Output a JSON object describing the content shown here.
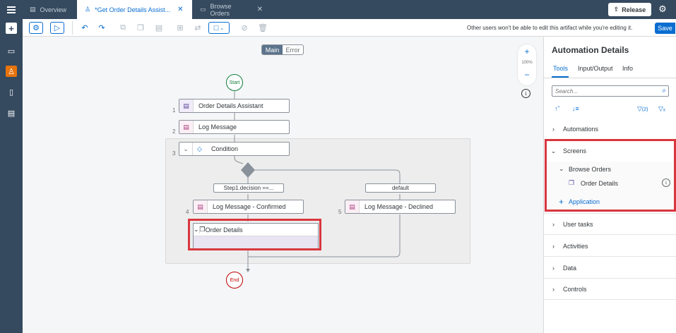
{
  "tabs": [
    {
      "label": "Overview"
    },
    {
      "label": "*Get Order Details Assist..."
    },
    {
      "label": "Browse Orders"
    }
  ],
  "header": {
    "release_label": "Release"
  },
  "toolbar": {
    "note": "Other users won't be able to edit this artifact while you're editing it.",
    "save_label": "Save"
  },
  "canvas": {
    "mode_tabs": [
      "Main",
      "Error"
    ],
    "zoom_level": "100%",
    "start_label": "Start",
    "end_label": "End",
    "steps": [
      {
        "num": "1",
        "label": "Order Details Assistant"
      },
      {
        "num": "2",
        "label": "Log Message"
      },
      {
        "num": "3",
        "label": "Condition"
      },
      {
        "num": "4",
        "label": "Log Message - Confirmed"
      },
      {
        "num": "5",
        "label": "Log Message - Declined"
      }
    ],
    "branches": [
      "Step1.decision ==...",
      "default"
    ],
    "screen_label": "Order Details"
  },
  "panel": {
    "title": "Automation Details",
    "tabs": [
      "Tools",
      "Input/Output",
      "Info"
    ],
    "search_placeholder": "Search...",
    "filter_count": "(2)",
    "sections": [
      "Automations",
      "Screens",
      "User tasks",
      "Activities",
      "Data",
      "Controls"
    ],
    "screens": {
      "group": "Browse Orders",
      "item": "Order Details",
      "add_label": "Application"
    }
  },
  "colors": {
    "accent": "#0a6ed1",
    "shell": "#354a5f",
    "highlight": "#d9363e",
    "nav_active": "#e9730c"
  }
}
